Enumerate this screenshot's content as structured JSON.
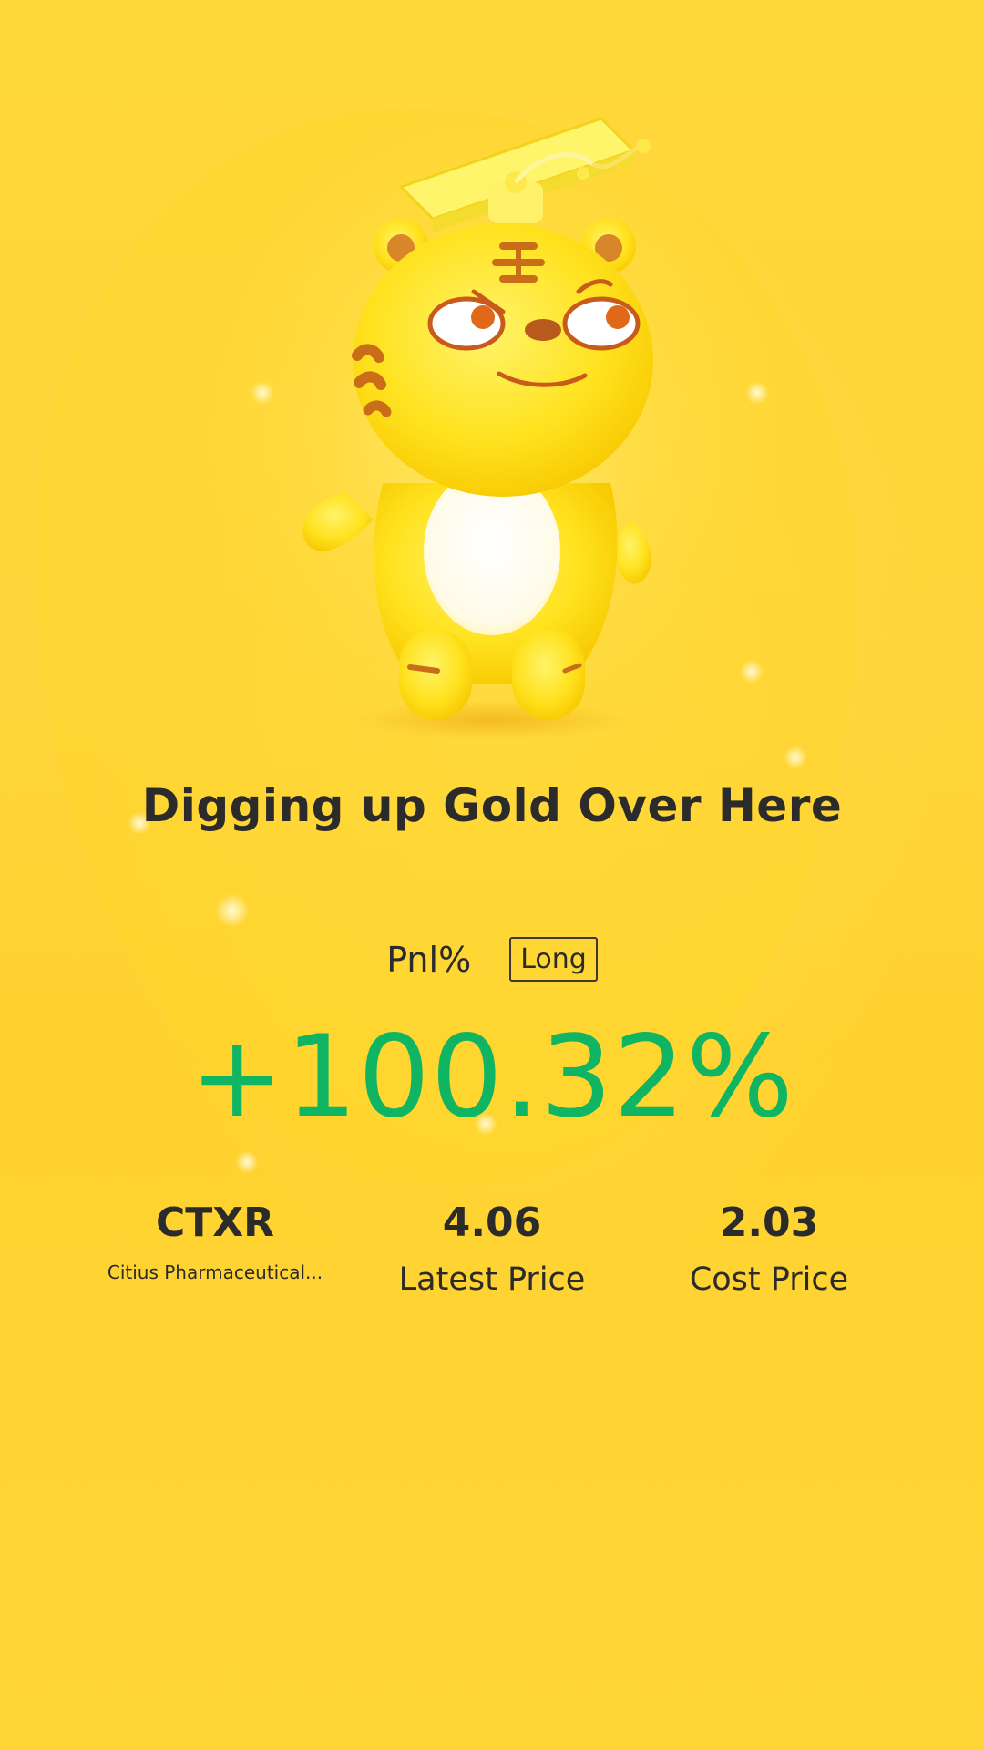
{
  "headline": "Digging up Gold Over Here",
  "pnl": {
    "label": "Pnl%",
    "side": "Long",
    "value": "+100.32%"
  },
  "stats": {
    "ticker": "CTXR",
    "company": "Citius Pharmaceutical...",
    "latest_price": "4.06",
    "latest_price_label": "Latest Price",
    "cost_price": "2.03",
    "cost_price_label": "Cost Price"
  },
  "colors": {
    "background": "#ffd43a",
    "profit_green": "#0fb563",
    "text_dark": "#2b2b2b",
    "mascot_yellow": "#ffe21f"
  },
  "illustration": "tiger-mascot-with-graduation-cap"
}
